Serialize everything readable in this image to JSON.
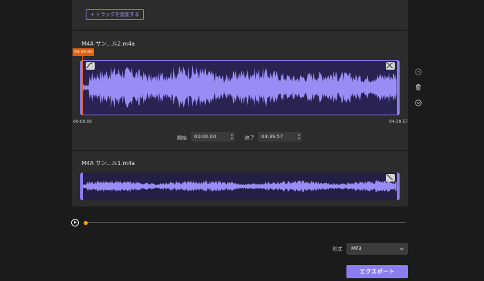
{
  "toolbar": {
    "add_track_label": "+ トラックを追加する"
  },
  "track1": {
    "title": "M4A サン...ル2.m4a",
    "playhead_time": "00:00.00",
    "start_time": "00:00.00",
    "end_time": "04:39.57",
    "start_label": "開始",
    "start_value": "00:00.00",
    "end_label": "終了",
    "end_value": "04:39.57",
    "fade_in_icon": "fade-in-icon",
    "fade_out_icon": "fade-out-icon"
  },
  "track2": {
    "title": "M4A サン...ル1.m4a",
    "fade_out_icon": "fade-out-icon"
  },
  "side_actions": [
    "move-up-icon",
    "trash-icon",
    "move-down-icon"
  ],
  "player": {
    "progress": 0.0
  },
  "output": {
    "format_label": "形式",
    "format_value": "MP3",
    "export_label": "エクスポート"
  },
  "colors": {
    "accent": "#8b7df0",
    "playhead": "#e85d04",
    "seek_thumb": "#f5a100"
  }
}
